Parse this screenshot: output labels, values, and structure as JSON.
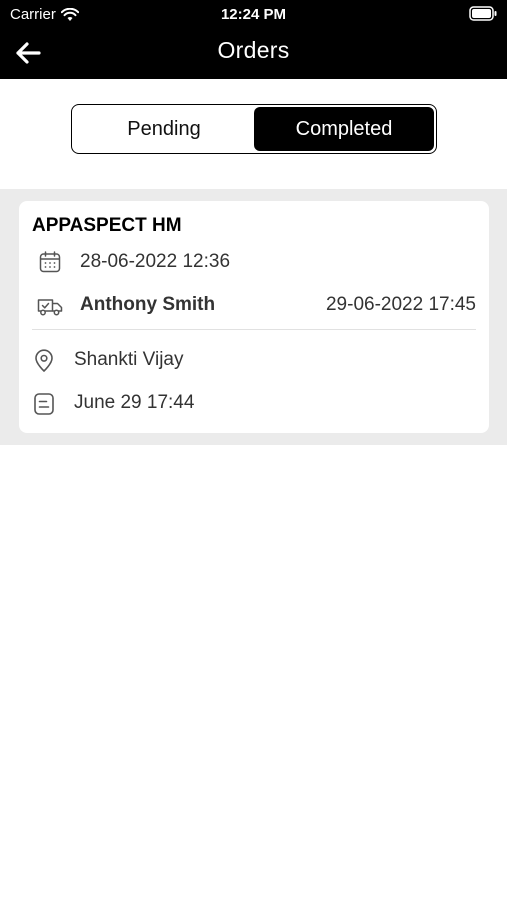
{
  "status_bar": {
    "carrier": "Carrier",
    "time": "12:24 PM"
  },
  "header": {
    "title": "Orders",
    "back_icon": "arrow-left-icon"
  },
  "tabs": [
    {
      "label": "Pending",
      "active": false
    },
    {
      "label": "Completed",
      "active": true
    }
  ],
  "orders": [
    {
      "customer": "APPASPECT HM",
      "order_date": "28-06-2022 12:36",
      "delivery_person": "Anthony Smith",
      "delivery_date": "29-06-2022 17:45",
      "location": "Shankti Vijay",
      "note": "June 29 17:44"
    }
  ],
  "colors": {
    "header_bg": "#000000",
    "active_tab": "#000000",
    "list_bg": "#ebebeb"
  }
}
